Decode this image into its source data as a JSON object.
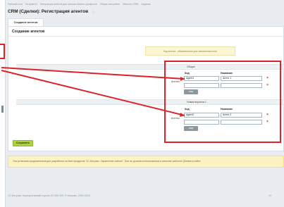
{
  "breadcrumbs": [
    "Рабочий стол",
    "Битрикс24",
    "Генераторы агентов для запуска бизнес-процессов",
    "Общие настройки",
    "Объекты CRM",
    "Задания"
  ],
  "page_title": "CRM (Сделки): Регистрация агентов",
  "tab": "Создание агентов",
  "section_title": "Создание агентов",
  "note": "Код агента - обязательное для заполнения поле",
  "groups": [
    {
      "title": "Общие",
      "col_code": "Код",
      "col_name": "Название",
      "row_label": "Агенты",
      "rows": [
        {
          "code": "Agent1",
          "name": "Агент 1"
        },
        {
          "code": "",
          "name": ""
        }
      ],
      "add_label": "еще"
    },
    {
      "title": "Новая воронка 1",
      "col_code": "Код",
      "col_name": "Название",
      "row_label": "Агенты",
      "rows": [
        {
          "code": "Agent2",
          "name": "Агент 2"
        },
        {
          "code": "",
          "name": ""
        }
      ],
      "add_label": "еще"
    }
  ],
  "delete_icon": "×",
  "save_label": "Сохранить",
  "warning": "Эта установка предназначена для разработки на базе продуктов \"1С-Битрикс: Управление сайтом\". Она не должна использоваться в качестве рабочего (боевого) сайта",
  "footer": {
    "copyright": "1С-Битрикс: Корпоративный портал 24.300.300. © Битрикс, 2002-2024",
    "link": "1С"
  },
  "colors": {
    "accent_red": "#d9242b",
    "save_green": "#aed143"
  }
}
